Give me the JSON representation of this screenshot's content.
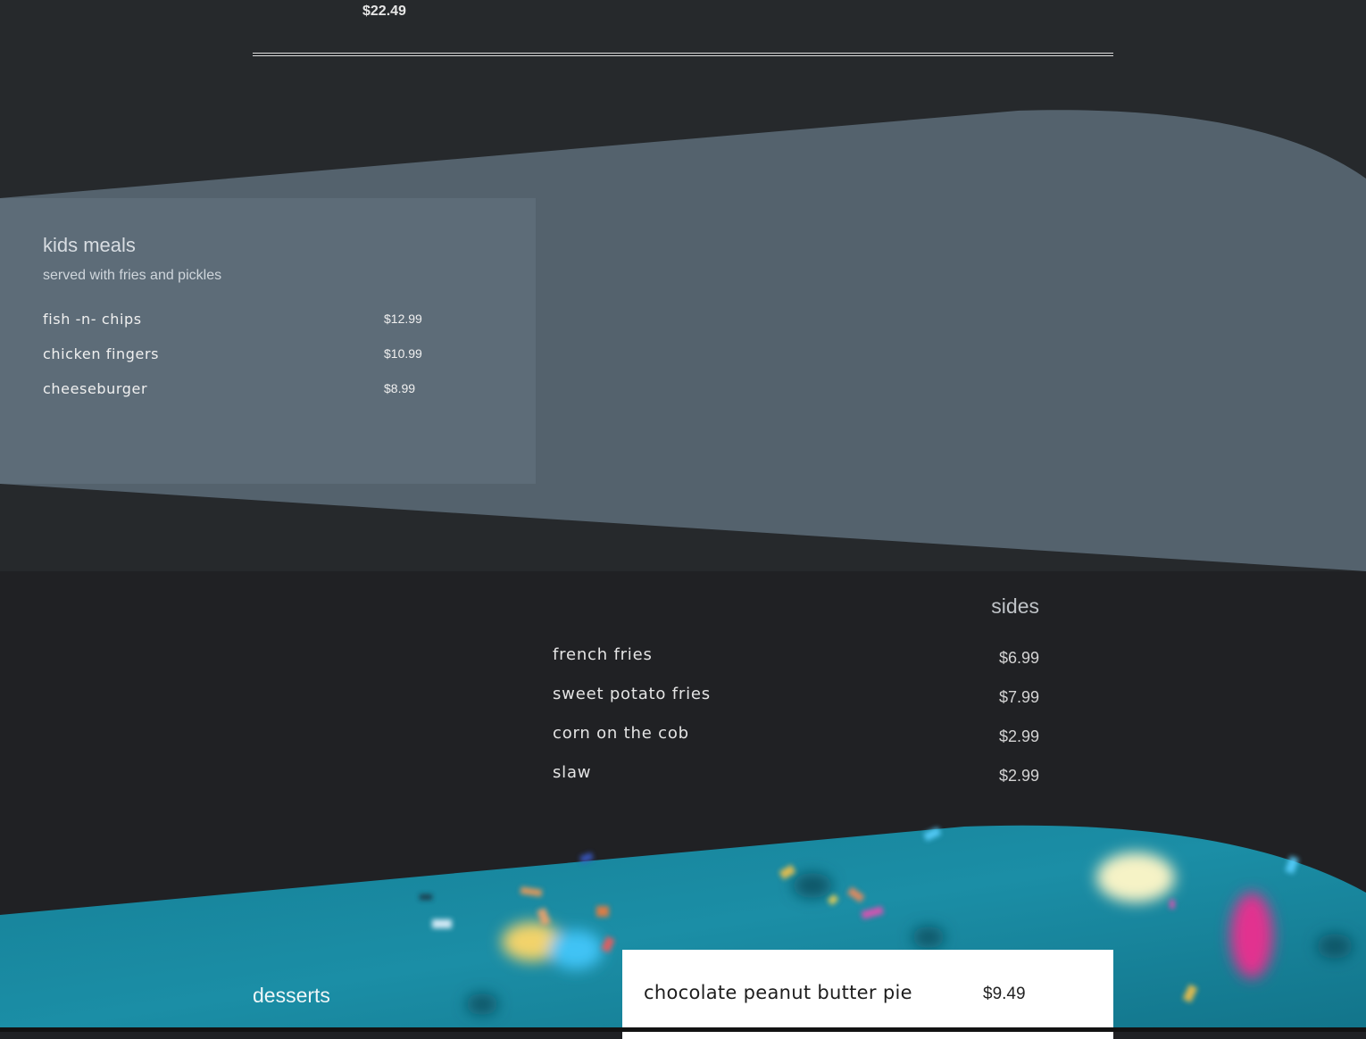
{
  "previous_section": {
    "price": "$22.49"
  },
  "kids_meals": {
    "title": "kids meals",
    "subtitle": "served with fries and pickles",
    "items": [
      {
        "name": "fish -n- chips",
        "price": "$12.99"
      },
      {
        "name": "chicken fingers",
        "price": "$10.99"
      },
      {
        "name": "cheeseburger",
        "price": "$8.99"
      }
    ]
  },
  "sides": {
    "title": "sides",
    "items": [
      {
        "name": "french fries",
        "price": "$6.99"
      },
      {
        "name": "sweet potato fries",
        "price": "$7.99"
      },
      {
        "name": "corn on the cob",
        "price": "$2.99"
      },
      {
        "name": "slaw",
        "price": "$2.99"
      }
    ]
  },
  "desserts": {
    "title": "desserts",
    "items": [
      {
        "name": "chocolate peanut butter pie",
        "price": "$9.49"
      }
    ]
  },
  "colors": {
    "dark_bg": "#26292c",
    "slate_shape": "#54626d",
    "kids_panel": "#5d6c78",
    "teal_confetti": "#1b8ea6"
  }
}
